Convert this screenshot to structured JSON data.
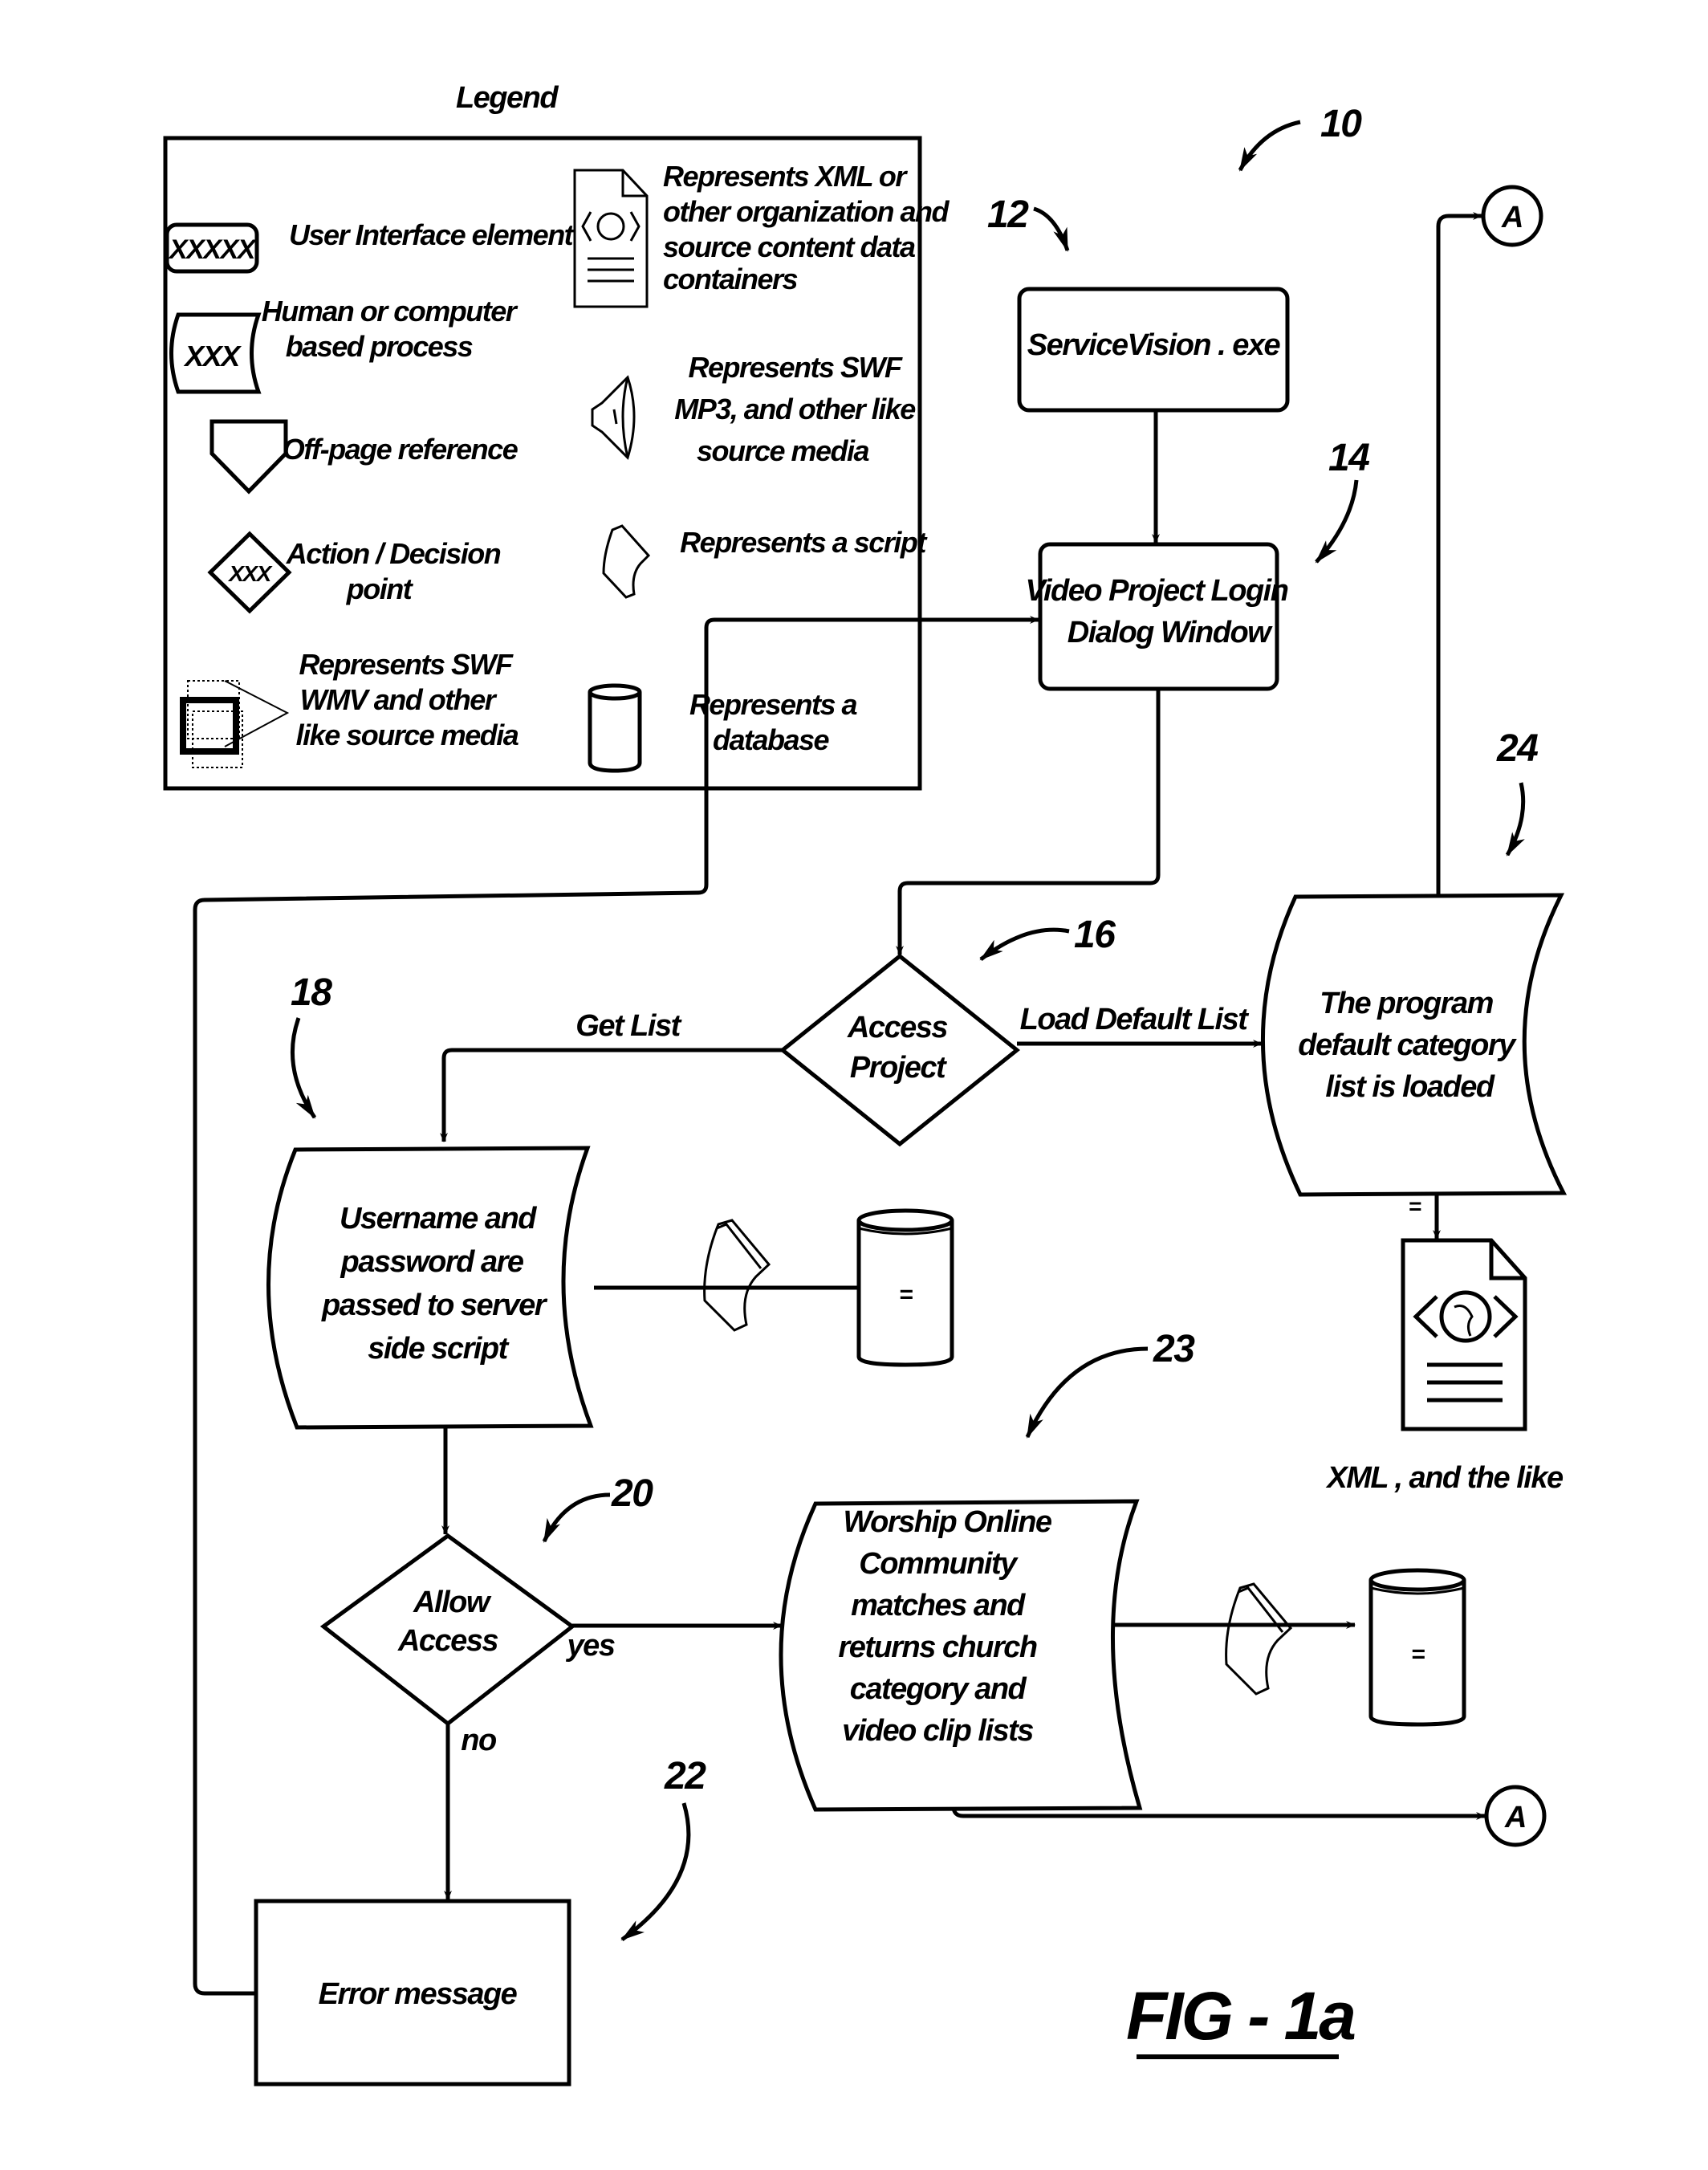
{
  "figure": {
    "label": "FIG - 1a",
    "ref_main": "10"
  },
  "legend": {
    "title": "Legend",
    "items": [
      {
        "symbol": "ui-element",
        "symbol_text": "XXXXX",
        "lines": [
          "User Interface element"
        ]
      },
      {
        "symbol": "process",
        "symbol_text": "XXX",
        "lines": [
          "Human or computer",
          "based process"
        ]
      },
      {
        "symbol": "off-page-reference",
        "lines": [
          "Off-page reference"
        ]
      },
      {
        "symbol": "decision",
        "symbol_text": "XXX",
        "lines": [
          "Action / Decision",
          "point"
        ]
      },
      {
        "symbol": "video-media",
        "lines": [
          "Represents SWF",
          "WMV and other",
          "like source media"
        ]
      },
      {
        "symbol": "xml-document",
        "lines": [
          "Represents XML or",
          "other organization and",
          "source content data",
          "containers"
        ]
      },
      {
        "symbol": "audio-media",
        "lines": [
          "Represents SWF",
          "MP3, and other like",
          "source media"
        ]
      },
      {
        "symbol": "script",
        "lines": [
          "Represents a script"
        ]
      },
      {
        "symbol": "database",
        "lines": [
          "Represents a",
          "database"
        ]
      }
    ]
  },
  "nodes": {
    "service_vision": {
      "ref": "12",
      "lines": [
        "ServiceVision . exe"
      ]
    },
    "login_dialog": {
      "ref": "14",
      "lines": [
        "Video Project Login",
        "Dialog Window"
      ]
    },
    "access_project": {
      "ref": "16",
      "lines": [
        "Access",
        "Project"
      ]
    },
    "username_password": {
      "ref": "18",
      "lines": [
        "Username and",
        "password are",
        "passed to server",
        "side script"
      ]
    },
    "allow_access": {
      "ref": "20",
      "lines": [
        "Allow",
        "Access"
      ]
    },
    "error_message": {
      "ref": "22",
      "lines": [
        "Error message"
      ]
    },
    "worship_online": {
      "ref": "23",
      "lines": [
        "Worship Online",
        "Community",
        "matches and",
        "returns church",
        "category and",
        "video clip lists"
      ]
    },
    "default_list": {
      "ref": "24",
      "lines": [
        "The program",
        "default category",
        "list is loaded"
      ]
    },
    "xml_output": {
      "caption": "XML ,  and the like"
    },
    "connector_top": {
      "label": "A"
    },
    "connector_bottom": {
      "label": "A"
    },
    "db_marker": "="
  },
  "edges": {
    "get_list": "Get List",
    "load_default": "Load Default List",
    "yes": "yes",
    "no": "no"
  }
}
